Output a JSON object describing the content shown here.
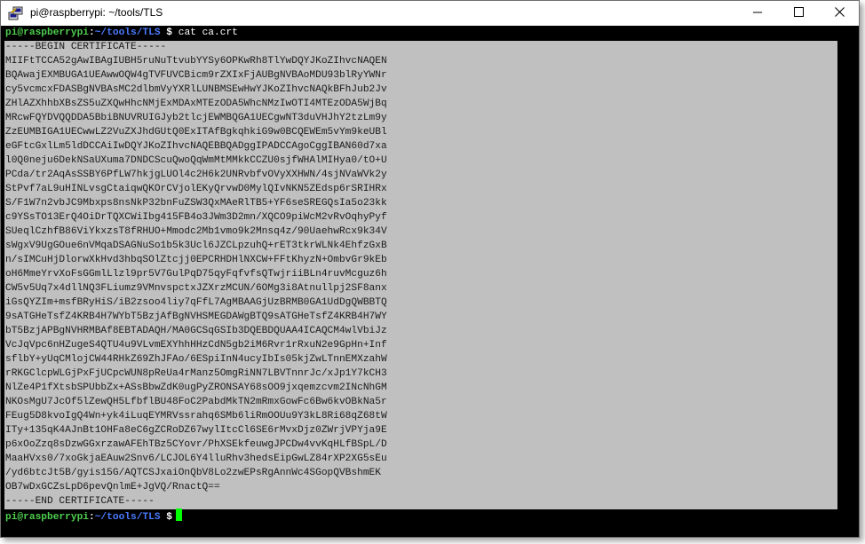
{
  "window": {
    "title": "pi@raspberrypi: ~/tools/TLS",
    "icons": {
      "app": "putty-icon",
      "minimize": "minimize-icon",
      "maximize": "maximize-icon",
      "close": "close-icon"
    }
  },
  "terminal": {
    "prompt_user": "pi@raspberrypi",
    "prompt_sep": ":",
    "prompt_path": "~/tools/TLS",
    "prompt_symbol": "$",
    "command": "cat ca.crt",
    "cert_lines": [
      "-----BEGIN CERTIFICATE-----",
      "MIIFtTCCA52gAwIBAgIUBH5ruNuTtvubYYSy6OPKwRh8TlYwDQYJKoZIhvcNAQEN",
      "BQAwajEXMBUGA1UEAwwOQW4gTVFUVCBicm9rZXIxFjAUBgNVBAoMDU93blRyYWNr",
      "cy5vcmcxFDASBgNVBAsMC2dlbmVyYXRlLUNBMSEwHwYJKoZIhvcNAQkBFhJub2Jv",
      "ZHlAZXhhbXBsZS5uZXQwHhcNMjExMDAxMTEzODA5WhcNMzIwOTI4MTEzODA5WjBq",
      "MRcwFQYDVQQDDA5BbiBNUVRUIGJyb2tlcjEWMBQGA1UECgwNT3duVHJhY2tzLm9y",
      "ZzEUMBIGA1UECwwLZ2VuZXJhdGUtQ0ExITAfBgkqhkiG9w0BCQEWEm5vYm9keUBl",
      "eGFtcGxlLm5ldDCCAiIwDQYJKoZIhvcNAQEBBQADggIPADCCAgoCggIBAN60d7xa",
      "l0Q0neju6DekNSaUXuma7DNDCScuQwoQqWmMtMMkkCCZU0sjfWHAlMIHya0/tO+U",
      "PCda/tr2AqAsSSBY6PfLW7hkjgLUOl4c2H6k2UNRvbfvOVyXXHWN/4sjNVaWVk2y",
      "StPvf7aL9uHINLvsgCtaiqwQKOrCVjolEKyQrvwD0MylQIvNKN5ZEdsp6rSRIHRx",
      "S/F1W7n2vbJC9Mbxps8nsNkP32bnFuZSW3QxMAeRlTB5+YF6seSREGQsIa5o23kk",
      "c9YSsTO13ErQ4OiDrTQXCWiIbg415FB4o3JWm3D2mn/XQCO9piWcM2vRvOqhyPyf",
      "SUeqlCzhfB86ViYkxzsT8fRHUO+Mmodc2Mb1vmo9k2Mnsq4z/90UaehwRcx9k34V",
      "sWgxV9UgGOue6nVMqaDSAGNuSo1b5k3Ucl6JZCLpzuhQ+rET3tkrWLNk4EhfzGxB",
      "n/sIMCuHjDlorwXkHvd3hbqSOlZtcjj0EPCRHDHlNXCW+FFtKhyzN+OmbvGr9kEb",
      "oH6MmeYrvXoFsGGmlLlzl9pr5V7GulPqD75qyFqfvfsQTwjriiBLn4ruvMcguz6h",
      "CW5v5Uq7x4dllNQ3FLiumz9VMnvspctxJZXrzMCUN/6OMg3i8Atnullpj2SF8anx",
      "iGsQYZIm+msfBRyHiS/iB2zsoo4liy7qFfL7AgMBAAGjUzBRMB0GA1UdDgQWBBTQ",
      "9sATGHeTsfZ4KRB4H7WYbT5BzjAfBgNVHSMEGDAWgBTQ9sATGHeTsfZ4KRB4H7WY",
      "bT5BzjAPBgNVHRMBAf8EBTADAQH/MA0GCSqGSIb3DQEBDQUAA4ICAQCM4wlVbiJz",
      "VcJqVpc6nHZugeS4QTU4u9VLvmEXYhhHHzCdN5gb2iM6Rvr1rRxuN2e9GpHn+Inf",
      "sflbY+yUqCMlojCW44RHkZ69ZhJFAo/6ESpiInN4ucyIbIs05kjZwLTnnEMXzahW",
      "rRKGClcpWLGjPxFjUCpcWUN8pReUa4rManz5OmgRiNN7LBVTnnrJc/xJp1Y7kCH3",
      "NlZe4P1fXtsbSPUbbZx+ASsBbwZdK0ugPyZRONSAY68sOO9jxqemzcvm2INcNhGM",
      "NKOsMgU7JcOf5lZewQH5LfbflBU48FoC2PabdMkTN2mRmxGowFc6Bw6kvOBkNa5r",
      "FEug5D8kvoIgQ4Wn+yk4iLuqEYMRVssrahq6SMb6liRmOOUu9Y3kL8Ri68qZ68tW",
      "ITy+135qK4AJnBt1OHFa8eC6gZCRoDZ67wylItcCl6SE6rMvxDjz0ZWrjVPYja9E",
      "p6xOoZzq8sDzwGGxrzawAFEhTBz5CYovr/PhXSEkfeuwgJPCDw4vvKqHLfBSpL/D",
      "MaaHVxs0/7xoGkjaEAuw2Snv6/LCJOL6Y4lluRhv3hedsEipGwLZ84rXP2XG5sEu",
      "/yd6btcJt5B/gyis15G/AQTCSJxaiOnQbV8Lo2zwEPsRgAnnWc4SGopQVBshmEK",
      "OB7wDxGCZsLpD6pevQnlmE+JgVQ/RnactQ==",
      "-----END CERTIFICATE-----"
    ],
    "colors": {
      "background": "#000000",
      "selection": "#c0c0c0",
      "prompt_user": "#4fcf4f",
      "prompt_path": "#4b7bff",
      "cursor": "#00ff00"
    }
  }
}
